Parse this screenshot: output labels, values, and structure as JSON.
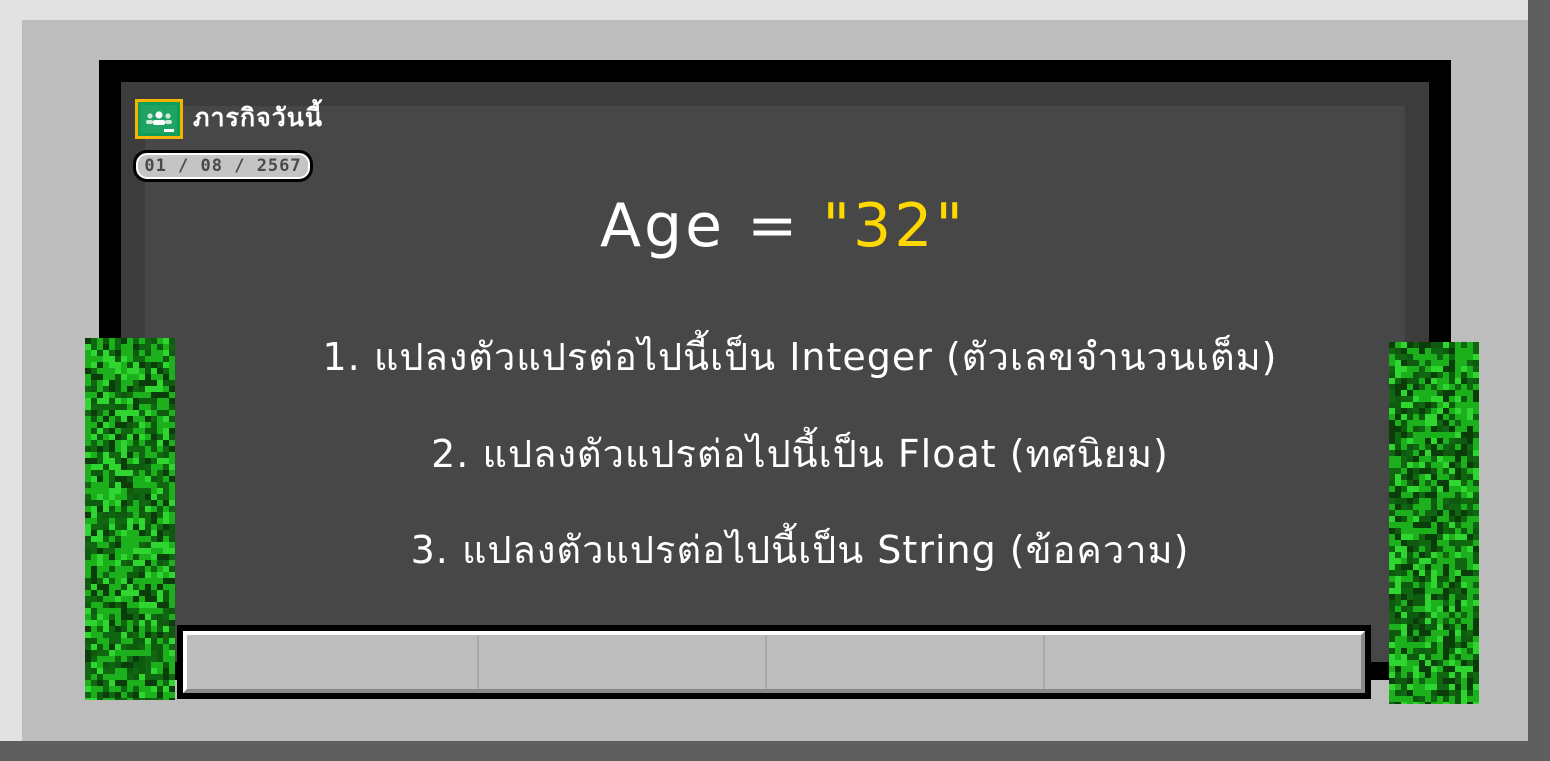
{
  "header": {
    "title": "ภารกิจวันนี้",
    "date": "01 / 08 / 2567",
    "icon": "google-classroom-icon"
  },
  "headline": {
    "variable": "Age",
    "operator": " = ",
    "value": "\"32\""
  },
  "tasks": [
    "1. แปลงตัวแปรต่อไปนี้เป็น Integer (ตัวเลขจำนวนเต็ม)",
    "2. แปลงตัวแปรต่อไปนี้เป็น Float (ทศนิยม)",
    "3. แปลงตัวแปรต่อไปนี้เป็น String (ข้อความ)"
  ],
  "colors": {
    "board": "#474747",
    "text": "#ffffff",
    "value": "#ffd800",
    "grass": "#1db01d",
    "icon_bg": "#f4b400",
    "icon_fg": "#0f9d58"
  }
}
